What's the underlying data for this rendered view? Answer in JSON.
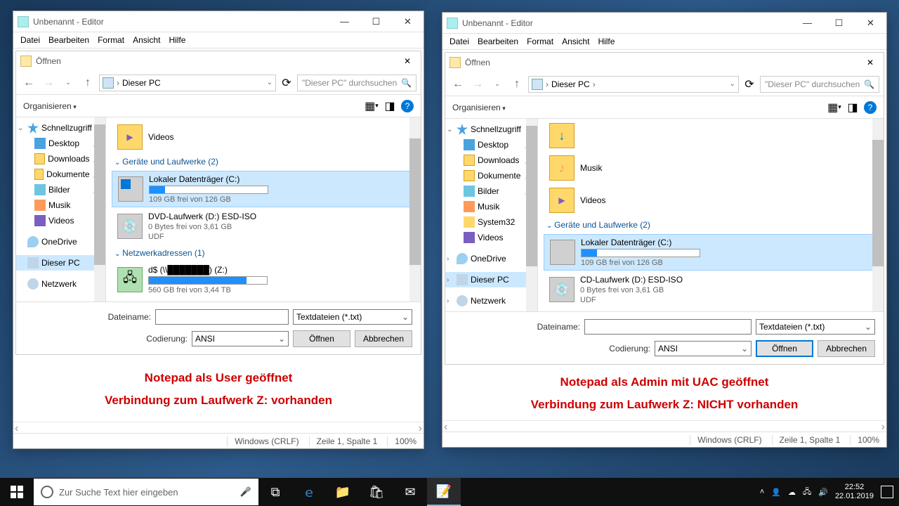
{
  "left": {
    "titlebar": "Unbenannt - Editor",
    "menu": [
      "Datei",
      "Bearbeiten",
      "Format",
      "Ansicht",
      "Hilfe"
    ],
    "dialog_title": "Öffnen",
    "breadcrumb": "Dieser PC",
    "search_placeholder": "\"Dieser PC\" durchsuchen",
    "organize": "Organisieren",
    "tree": [
      {
        "label": "Schnellzugriff",
        "icon": "ic-quick",
        "expanded": true
      },
      {
        "label": "Desktop",
        "icon": "ic-desktop",
        "pinned": true
      },
      {
        "label": "Downloads",
        "icon": "ic-folder",
        "pinned": true
      },
      {
        "label": "Dokumente",
        "icon": "ic-folder",
        "pinned": true
      },
      {
        "label": "Bilder",
        "icon": "ic-pic",
        "pinned": true
      },
      {
        "label": "Musik",
        "icon": "ic-music"
      },
      {
        "label": "Videos",
        "icon": "ic-video"
      },
      {
        "label": "OneDrive",
        "icon": "ic-onedrive"
      },
      {
        "label": "Dieser PC",
        "icon": "ic-pc",
        "selected": true
      },
      {
        "label": "Netzwerk",
        "icon": "ic-net"
      }
    ],
    "content": {
      "top_item": {
        "name": "Videos"
      },
      "sec1": "Geräte und Laufwerke (2)",
      "drives": [
        {
          "name": "Lokaler Datenträger (C:)",
          "free": "109 GB frei von 126 GB",
          "pct": 13,
          "type": "win",
          "selected": true
        },
        {
          "name": "DVD-Laufwerk (D:) ESD-ISO",
          "free": "0 Bytes frei von 3,61 GB",
          "fs": "UDF",
          "type": "dvd"
        }
      ],
      "sec2": "Netzwerkadressen (1)",
      "net": [
        {
          "name": "d$ (\\\\███████) (Z:)",
          "free": "560 GB frei von 3,44 TB",
          "pct": 83,
          "type": "net"
        }
      ]
    },
    "file_label": "Dateiname:",
    "enc_label": "Codierung:",
    "filter": "Textdateien (*.txt)",
    "encoding": "ANSI",
    "open": "Öffnen",
    "cancel": "Abbrechen",
    "caption1": "Notepad als User geöffnet",
    "caption2": "Verbindung zum Laufwerk Z: vorhanden",
    "status": {
      "enc": "Windows (CRLF)",
      "pos": "Zeile 1, Spalte 1",
      "zoom": "100%"
    }
  },
  "right": {
    "titlebar": "Unbenannt - Editor",
    "menu": [
      "Datei",
      "Bearbeiten",
      "Format",
      "Ansicht",
      "Hilfe"
    ],
    "dialog_title": "Öffnen",
    "breadcrumb": "Dieser PC",
    "search_placeholder": "\"Dieser PC\" durchsuchen",
    "organize": "Organisieren",
    "tree": [
      {
        "label": "Schnellzugriff",
        "icon": "ic-quick",
        "expanded": true
      },
      {
        "label": "Desktop",
        "icon": "ic-desktop",
        "pinned": true
      },
      {
        "label": "Downloads",
        "icon": "ic-folder",
        "pinned": true
      },
      {
        "label": "Dokumente",
        "icon": "ic-folder",
        "pinned": true
      },
      {
        "label": "Bilder",
        "icon": "ic-pic",
        "pinned": true
      },
      {
        "label": "Musik",
        "icon": "ic-music"
      },
      {
        "label": "System32",
        "icon": "ic-sys"
      },
      {
        "label": "Videos",
        "icon": "ic-video"
      },
      {
        "label": "OneDrive",
        "icon": "ic-onedrive",
        "collapsed": true
      },
      {
        "label": "Dieser PC",
        "icon": "ic-pc",
        "selected": true,
        "collapsed": true
      },
      {
        "label": "Netzwerk",
        "icon": "ic-net",
        "collapsed": true
      }
    ],
    "content": {
      "folders": [
        {
          "name": "",
          "type": "dl"
        },
        {
          "name": "Musik",
          "type": "music"
        },
        {
          "name": "Videos",
          "type": "video"
        }
      ],
      "sec1": "Geräte und Laufwerke (2)",
      "drives": [
        {
          "name": "Lokaler Datenträger (C:)",
          "free": "109 GB frei von 126 GB",
          "pct": 13,
          "type": "drive",
          "selected": true
        },
        {
          "name": "CD-Laufwerk (D:) ESD-ISO",
          "free": "0 Bytes frei von 3,61 GB",
          "fs": "UDF",
          "type": "dvd"
        }
      ]
    },
    "file_label": "Dateiname:",
    "enc_label": "Codierung:",
    "filter": "Textdateien (*.txt)",
    "encoding": "ANSI",
    "open": "Öffnen",
    "cancel": "Abbrechen",
    "caption1": "Notepad als Admin mit UAC geöffnet",
    "caption2": "Verbindung zum Laufwerk Z: NICHT vorhanden",
    "status": {
      "enc": "Windows (CRLF)",
      "pos": "Zeile 1, Spalte 1",
      "zoom": "100%"
    }
  },
  "taskbar": {
    "search": "Zur Suche Text hier eingeben",
    "time": "22:52",
    "date": "22.01.2019"
  }
}
